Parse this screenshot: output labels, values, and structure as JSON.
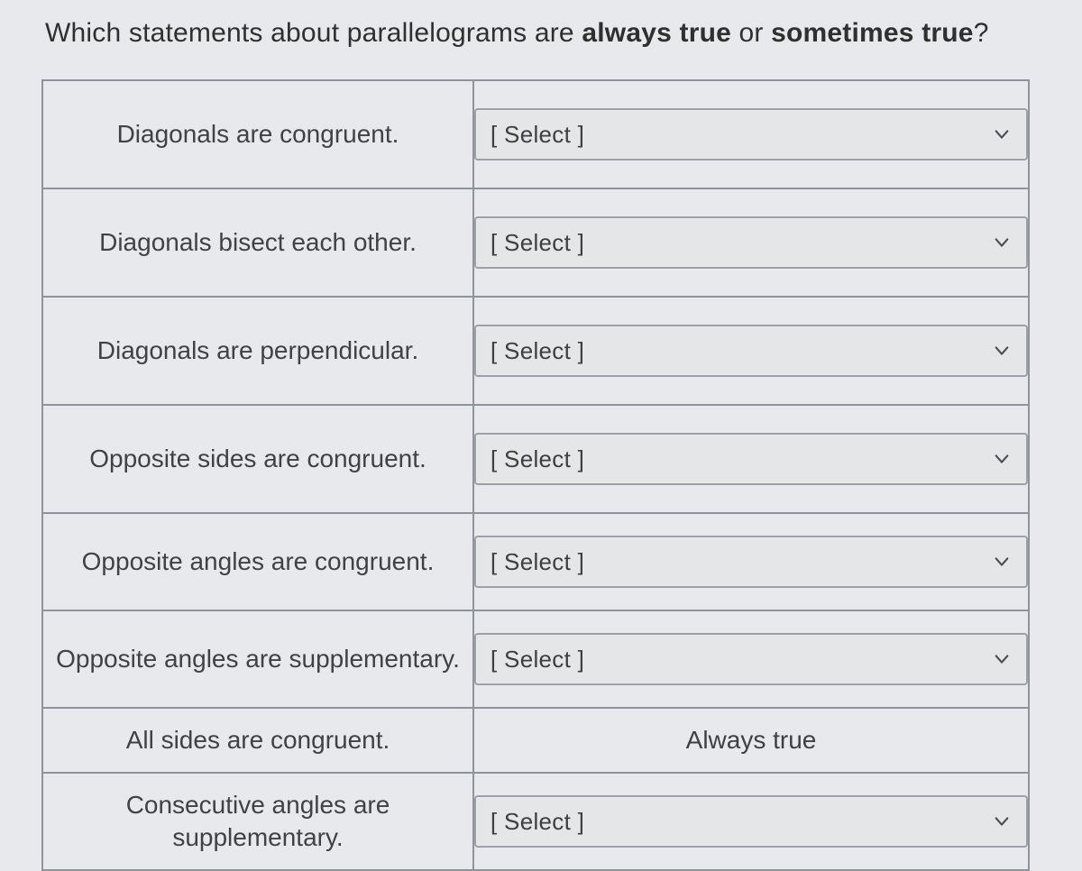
{
  "question": {
    "prefix": "Which statements about parallelograms are ",
    "bold1": "always true",
    "middle": " or ",
    "bold2": "sometimes true",
    "suffix": "?"
  },
  "select_placeholder": "[ Select ]",
  "rows": [
    {
      "statement": "Diagonals are congruent.",
      "type": "select",
      "value": "[ Select ]"
    },
    {
      "statement": "Diagonals bisect each other.",
      "type": "select",
      "value": "[ Select ]"
    },
    {
      "statement": "Diagonals are perpendicular.",
      "type": "select",
      "value": "[ Select ]"
    },
    {
      "statement": "Opposite sides are congruent.",
      "type": "select",
      "value": "[ Select ]"
    },
    {
      "statement": "Opposite angles are congruent.",
      "type": "select",
      "value": "[ Select ]"
    },
    {
      "statement": "Opposite angles are supplementary.",
      "type": "select",
      "value": "[ Select ]"
    },
    {
      "statement": "All sides are congruent.",
      "type": "text",
      "value": "Always true"
    },
    {
      "statement": "Consecutive angles are supplementary.",
      "type": "select",
      "value": "[ Select ]"
    }
  ]
}
